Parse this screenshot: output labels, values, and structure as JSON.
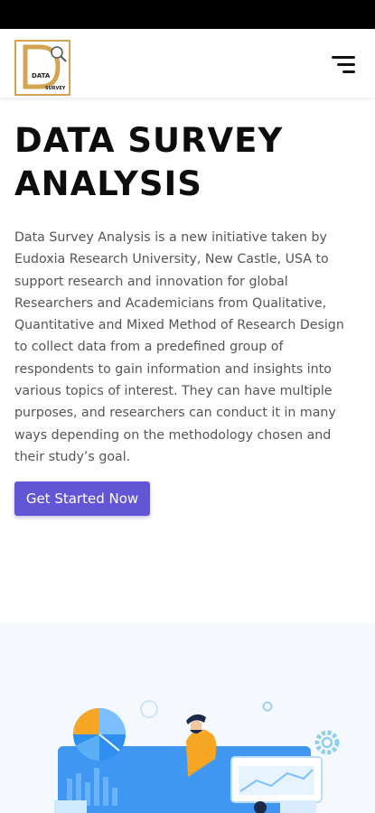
{
  "header": {
    "logo": {
      "line1": "DATA",
      "line2": "SURVEY"
    },
    "menu_icon": "hamburger-menu-icon"
  },
  "hero": {
    "title": "DATA SURVEY ANALYSIS",
    "description": "Data Survey Analysis is a new initiative taken by Eudoxia Research University, New Castle, USA to support research and innovation for global Researchers and Academicians from Qualitative, Quantitative and Mixed Method of Research Design to collect data from a predefined group of respondents to gain information and insights into various topics of interest. They can have multiple purposes, and researchers can conduct it in many ways depending on the methodology chosen and their study’s goal.",
    "cta_label": "Get Started Now"
  },
  "colors": {
    "accent": "#6056d6",
    "logo_gold": "#d4a453",
    "illustration_blue": "#2f8ff0",
    "illustration_orange": "#f6a623"
  },
  "illustration": {
    "icons": [
      "pie-chart-icon",
      "person-icon",
      "gear-icon",
      "dashboard-icon"
    ]
  }
}
